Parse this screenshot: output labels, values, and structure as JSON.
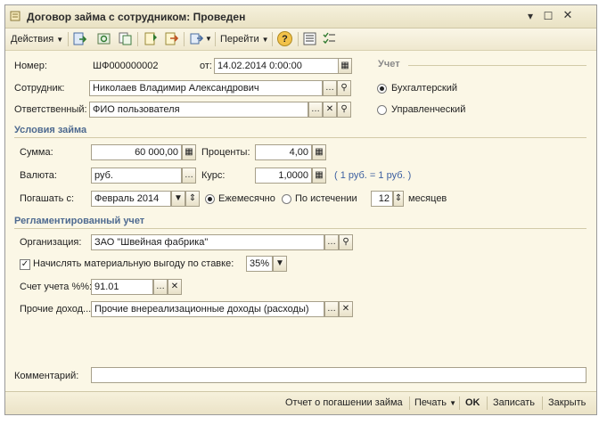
{
  "window": {
    "title": "Договор займа с сотрудником: Проведен",
    "controls": {
      "menu": "▾",
      "restore": "☐",
      "close": "✕"
    }
  },
  "toolbar": {
    "actions_label": "Действия",
    "goto_label": "Перейти",
    "help_label": "?"
  },
  "form": {
    "number_label": "Номер:",
    "number_value": "ШФ000000002",
    "date_label": "от:",
    "date_value": "14.02.2014  0:00:00",
    "employee_label": "Сотрудник:",
    "employee_value": "Николаев Владимир Александрович",
    "responsible_label": "Ответственный:",
    "responsible_value": "ФИО пользователя",
    "uchet_title": "Учет",
    "uchet_options": [
      "Бухгалтерский",
      "Управленческий"
    ],
    "uchet_selected": "Бухгалтерский"
  },
  "loan_terms": {
    "section_title": "Условия займа",
    "sum_label": "Сумма:",
    "sum_value": "60 000,00",
    "percent_label": "Проценты:",
    "percent_value": "4,00",
    "currency_label": "Валюта:",
    "currency_value": "руб.",
    "rate_label": "Курс:",
    "rate_value": "1,0000",
    "rate_note": "( 1 руб. = 1 руб. )",
    "repay_label": "Погашать с:",
    "repay_value": "Февраль 2014",
    "monthly_label": "Ежемесячно",
    "at_end_label": "По истечении",
    "months_value": "12",
    "months_label": "месяцев",
    "schedule_selected": "Ежемесячно"
  },
  "regulated": {
    "section_title": "Регламентированный учет",
    "org_label": "Организация:",
    "org_value": "ЗАО \"Швейная фабрика\"",
    "benefit_label": "Начислять материальную выгоду по ставке:",
    "benefit_checked": true,
    "benefit_rate": "35%",
    "account_label": "Счет учета %%:",
    "account_value": "91.01",
    "other_income_label": "Прочие доход...",
    "other_income_value": "Прочие внереализационные доходы (расходы)"
  },
  "comment": {
    "label": "Комментарий:",
    "value": ""
  },
  "bottom": {
    "report_label": "Отчет о погашении займа",
    "print_label": "Печать",
    "ok_label": "OK",
    "save_label": "Записать",
    "close_label": "Закрыть"
  },
  "colors": {
    "background": "#fbf7e6",
    "section_title": "#4e6a90",
    "rate_note": "#3c5fa0"
  }
}
